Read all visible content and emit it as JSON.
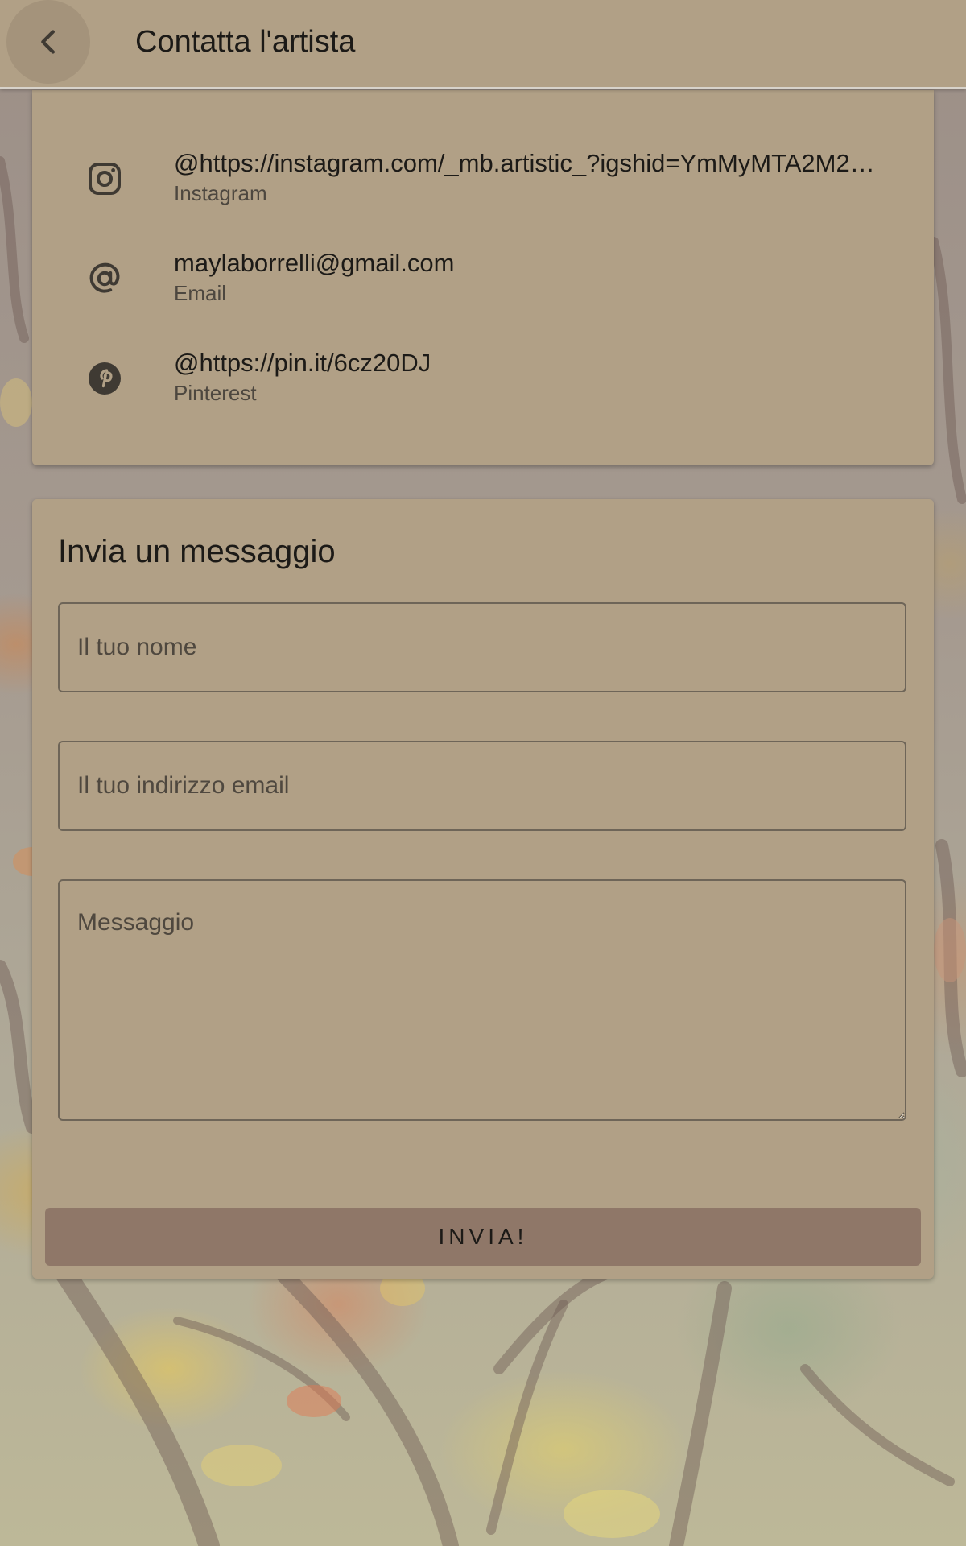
{
  "header": {
    "title": "Contatta l'artista",
    "back_icon": "chevron-left-icon"
  },
  "contacts": [
    {
      "icon": "instagram-icon",
      "value": "@https://instagram.com/_mb.artistic_?igshid=YmMyMTA2M2…",
      "type": "Instagram"
    },
    {
      "icon": "at-sign-icon",
      "value": "maylaborrelli@gmail.com",
      "type": "Email"
    },
    {
      "icon": "pinterest-icon",
      "value": "@https://pin.it/6cz20DJ",
      "type": "Pinterest"
    }
  ],
  "form": {
    "title": "Invia un messaggio",
    "name_placeholder": "Il tuo nome",
    "email_placeholder": "Il tuo indirizzo email",
    "message_placeholder": "Messaggio",
    "name_value": "",
    "email_value": "",
    "message_value": "",
    "submit_label": "INVIA!"
  },
  "colors": {
    "surface": "#b1a086",
    "button": "#8f7768",
    "text": "#1c1a17",
    "secondary_text": "#4d473f"
  }
}
